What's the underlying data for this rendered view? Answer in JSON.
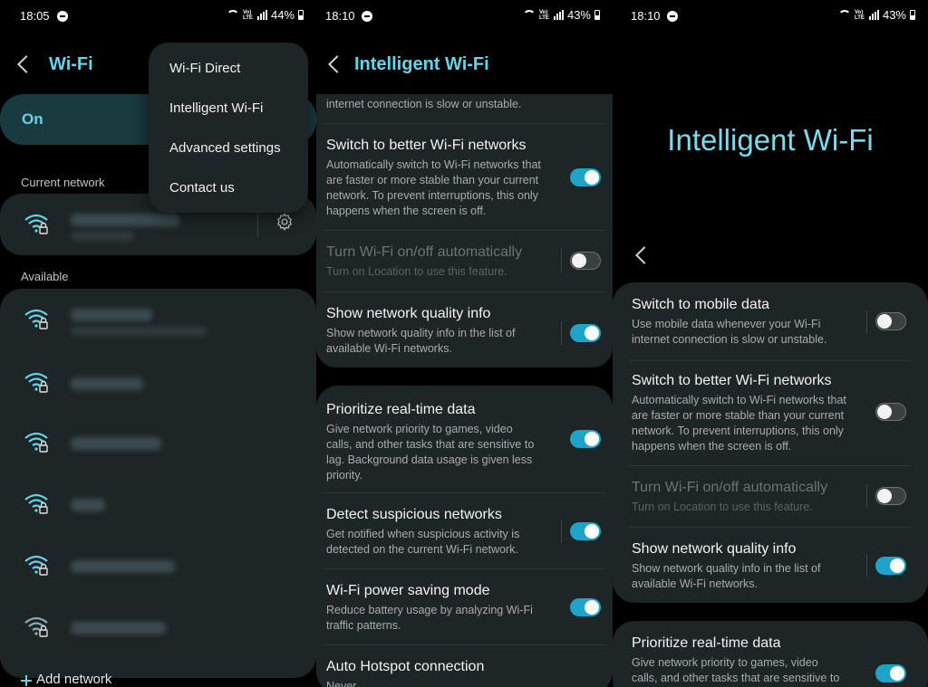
{
  "screen1": {
    "status": {
      "time": "18:05",
      "battery": "44%"
    },
    "title": "Wi-Fi",
    "wifi_switch_label": "On",
    "current_network_label": "Current network",
    "available_label": "Available",
    "menu": [
      "Wi-Fi Direct",
      "Intelligent Wi-Fi",
      "Advanced settings",
      "Contact us"
    ],
    "add_network_label": "Add network"
  },
  "screen2": {
    "status": {
      "time": "18:10",
      "battery": "43%"
    },
    "title": "Intelligent Wi-Fi",
    "top_fragment": "internet connection is slow or unstable.",
    "items": [
      {
        "title": "Switch to better Wi-Fi networks",
        "desc": [
          "Automatically switch to Wi-Fi networks that",
          "are faster or more stable than your current",
          "network. To prevent interruptions, this only",
          "happens when the screen is off."
        ],
        "state": "on"
      },
      {
        "title": "Turn Wi-Fi on/off automatically",
        "desc": [
          "Turn on Location to use this feature."
        ],
        "state": "off"
      },
      {
        "title": "Show network quality info",
        "desc": [
          "Show network quality info in the list of",
          "available Wi-Fi networks."
        ],
        "state": "on"
      },
      {
        "title": "Prioritize real-time data",
        "desc": [
          "Give network priority to games, video",
          "calls, and other tasks that are sensitive to",
          "lag. Background data usage is given less",
          "priority."
        ],
        "state": "on"
      },
      {
        "title": "Detect suspicious networks",
        "desc": [
          "Get notified when suspicious activity is",
          "detected on the current Wi-Fi network."
        ],
        "state": "on"
      },
      {
        "title": "Wi-Fi power saving mode",
        "desc": [
          "Reduce battery usage by analyzing Wi-Fi",
          "traffic patterns."
        ],
        "state": "on"
      },
      {
        "title": "Auto Hotspot connection",
        "desc": [
          "Never"
        ],
        "state": "none"
      }
    ]
  },
  "screen3": {
    "status": {
      "time": "18:10",
      "battery": "43%"
    },
    "big_title": "Intelligent Wi-Fi",
    "items": [
      {
        "title": "Switch to mobile data",
        "desc": [
          "Use mobile data whenever your Wi-Fi",
          "internet connection is slow or unstable."
        ],
        "state": "off"
      },
      {
        "title": "Switch to better Wi-Fi networks",
        "desc": [
          "Automatically switch to Wi-Fi networks that",
          "are faster or more stable than your current",
          "network. To prevent interruptions, this only",
          "happens when the screen is off."
        ],
        "state": "off"
      },
      {
        "title": "Turn Wi-Fi on/off automatically",
        "desc": [
          "Turn on Location to use this feature."
        ],
        "state": "off"
      },
      {
        "title": "Show network quality info",
        "desc": [
          "Show network quality info in the list of",
          "available Wi-Fi networks."
        ],
        "state": "on"
      },
      {
        "title": "Prioritize real-time data",
        "desc": [
          "Give network priority to games, video",
          "calls, and other tasks that are sensitive to"
        ],
        "state": "on"
      }
    ]
  },
  "colors": {
    "accent": "#65d4e9",
    "toggle_on": "#1fa3c9",
    "card": "#1e2527",
    "background": "#000000"
  }
}
